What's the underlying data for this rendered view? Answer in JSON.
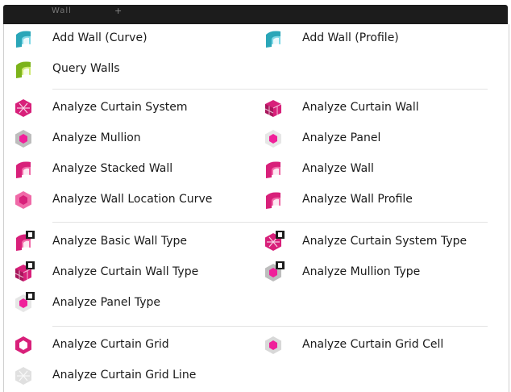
{
  "titlebar": {
    "title": "Wall",
    "pin": "+"
  },
  "groups": [
    [
      {
        "label": "Add Wall (Curve)",
        "icon": "add-wall-curve-icon"
      },
      {
        "label": "Add Wall (Profile)",
        "icon": "add-wall-profile-icon"
      },
      {
        "label": "Query Walls",
        "icon": "query-walls-icon"
      }
    ],
    [
      {
        "label": "Analyze Curtain System",
        "icon": "analyze-curtain-system-icon"
      },
      {
        "label": "Analyze Curtain Wall",
        "icon": "analyze-curtain-wall-icon"
      },
      {
        "label": "Analyze Mullion",
        "icon": "analyze-mullion-icon"
      },
      {
        "label": "Analyze Panel",
        "icon": "analyze-panel-icon"
      },
      {
        "label": "Analyze Stacked Wall",
        "icon": "analyze-stacked-wall-icon"
      },
      {
        "label": "Analyze Wall",
        "icon": "analyze-wall-icon"
      },
      {
        "label": "Analyze Wall Location Curve",
        "icon": "analyze-wall-location-curve-icon"
      },
      {
        "label": "Analyze Wall Profile",
        "icon": "analyze-wall-profile-icon"
      }
    ],
    [
      {
        "label": "Analyze Basic Wall Type",
        "icon": "analyze-basic-wall-type-icon"
      },
      {
        "label": "Analyze Curtain System Type",
        "icon": "analyze-curtain-system-type-icon"
      },
      {
        "label": "Analyze Curtain Wall Type",
        "icon": "analyze-curtain-wall-type-icon"
      },
      {
        "label": "Analyze Mullion Type",
        "icon": "analyze-mullion-type-icon"
      },
      {
        "label": "Analyze Panel Type",
        "icon": "analyze-panel-type-icon"
      }
    ],
    [
      {
        "label": "Analyze Curtain Grid",
        "icon": "analyze-curtain-grid-icon"
      },
      {
        "label": "Analyze Curtain Grid Cell",
        "icon": "analyze-curtain-grid-cell-icon"
      },
      {
        "label": "Analyze Curtain Grid Line",
        "icon": "analyze-curtain-grid-line-icon"
      }
    ]
  ],
  "colors": {
    "teal": "#2aa6b8",
    "lime": "#a6d21e",
    "magenta": "#d8207a",
    "pink": "#f0209a",
    "grey": "#bdbdbd",
    "dark": "#1c1c1c"
  }
}
